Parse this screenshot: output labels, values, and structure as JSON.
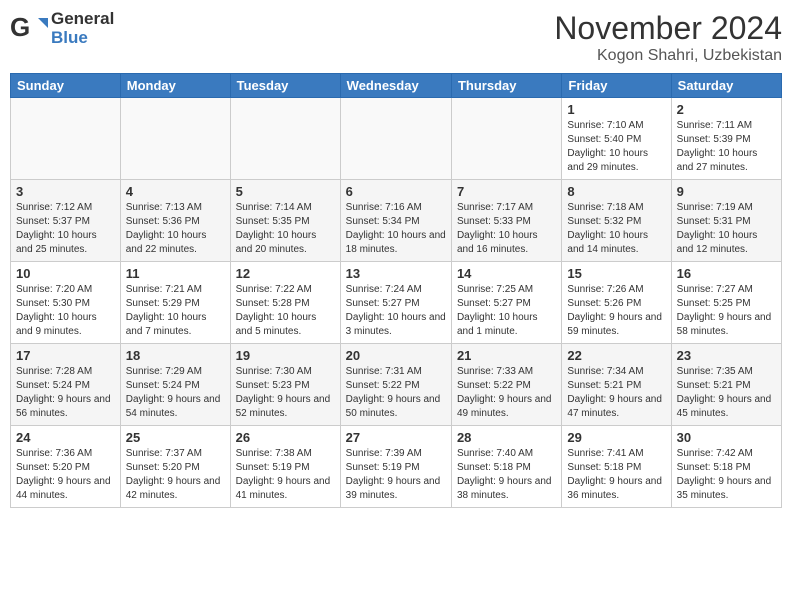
{
  "header": {
    "logo_general": "General",
    "logo_blue": "Blue",
    "month_title": "November 2024",
    "location": "Kogon Shahri, Uzbekistan"
  },
  "days_of_week": [
    "Sunday",
    "Monday",
    "Tuesday",
    "Wednesday",
    "Thursday",
    "Friday",
    "Saturday"
  ],
  "weeks": [
    {
      "days": [
        {
          "num": "",
          "info": ""
        },
        {
          "num": "",
          "info": ""
        },
        {
          "num": "",
          "info": ""
        },
        {
          "num": "",
          "info": ""
        },
        {
          "num": "",
          "info": ""
        },
        {
          "num": "1",
          "info": "Sunrise: 7:10 AM\nSunset: 5:40 PM\nDaylight: 10 hours and 29 minutes."
        },
        {
          "num": "2",
          "info": "Sunrise: 7:11 AM\nSunset: 5:39 PM\nDaylight: 10 hours and 27 minutes."
        }
      ]
    },
    {
      "days": [
        {
          "num": "3",
          "info": "Sunrise: 7:12 AM\nSunset: 5:37 PM\nDaylight: 10 hours and 25 minutes."
        },
        {
          "num": "4",
          "info": "Sunrise: 7:13 AM\nSunset: 5:36 PM\nDaylight: 10 hours and 22 minutes."
        },
        {
          "num": "5",
          "info": "Sunrise: 7:14 AM\nSunset: 5:35 PM\nDaylight: 10 hours and 20 minutes."
        },
        {
          "num": "6",
          "info": "Sunrise: 7:16 AM\nSunset: 5:34 PM\nDaylight: 10 hours and 18 minutes."
        },
        {
          "num": "7",
          "info": "Sunrise: 7:17 AM\nSunset: 5:33 PM\nDaylight: 10 hours and 16 minutes."
        },
        {
          "num": "8",
          "info": "Sunrise: 7:18 AM\nSunset: 5:32 PM\nDaylight: 10 hours and 14 minutes."
        },
        {
          "num": "9",
          "info": "Sunrise: 7:19 AM\nSunset: 5:31 PM\nDaylight: 10 hours and 12 minutes."
        }
      ]
    },
    {
      "days": [
        {
          "num": "10",
          "info": "Sunrise: 7:20 AM\nSunset: 5:30 PM\nDaylight: 10 hours and 9 minutes."
        },
        {
          "num": "11",
          "info": "Sunrise: 7:21 AM\nSunset: 5:29 PM\nDaylight: 10 hours and 7 minutes."
        },
        {
          "num": "12",
          "info": "Sunrise: 7:22 AM\nSunset: 5:28 PM\nDaylight: 10 hours and 5 minutes."
        },
        {
          "num": "13",
          "info": "Sunrise: 7:24 AM\nSunset: 5:27 PM\nDaylight: 10 hours and 3 minutes."
        },
        {
          "num": "14",
          "info": "Sunrise: 7:25 AM\nSunset: 5:27 PM\nDaylight: 10 hours and 1 minute."
        },
        {
          "num": "15",
          "info": "Sunrise: 7:26 AM\nSunset: 5:26 PM\nDaylight: 9 hours and 59 minutes."
        },
        {
          "num": "16",
          "info": "Sunrise: 7:27 AM\nSunset: 5:25 PM\nDaylight: 9 hours and 58 minutes."
        }
      ]
    },
    {
      "days": [
        {
          "num": "17",
          "info": "Sunrise: 7:28 AM\nSunset: 5:24 PM\nDaylight: 9 hours and 56 minutes."
        },
        {
          "num": "18",
          "info": "Sunrise: 7:29 AM\nSunset: 5:24 PM\nDaylight: 9 hours and 54 minutes."
        },
        {
          "num": "19",
          "info": "Sunrise: 7:30 AM\nSunset: 5:23 PM\nDaylight: 9 hours and 52 minutes."
        },
        {
          "num": "20",
          "info": "Sunrise: 7:31 AM\nSunset: 5:22 PM\nDaylight: 9 hours and 50 minutes."
        },
        {
          "num": "21",
          "info": "Sunrise: 7:33 AM\nSunset: 5:22 PM\nDaylight: 9 hours and 49 minutes."
        },
        {
          "num": "22",
          "info": "Sunrise: 7:34 AM\nSunset: 5:21 PM\nDaylight: 9 hours and 47 minutes."
        },
        {
          "num": "23",
          "info": "Sunrise: 7:35 AM\nSunset: 5:21 PM\nDaylight: 9 hours and 45 minutes."
        }
      ]
    },
    {
      "days": [
        {
          "num": "24",
          "info": "Sunrise: 7:36 AM\nSunset: 5:20 PM\nDaylight: 9 hours and 44 minutes."
        },
        {
          "num": "25",
          "info": "Sunrise: 7:37 AM\nSunset: 5:20 PM\nDaylight: 9 hours and 42 minutes."
        },
        {
          "num": "26",
          "info": "Sunrise: 7:38 AM\nSunset: 5:19 PM\nDaylight: 9 hours and 41 minutes."
        },
        {
          "num": "27",
          "info": "Sunrise: 7:39 AM\nSunset: 5:19 PM\nDaylight: 9 hours and 39 minutes."
        },
        {
          "num": "28",
          "info": "Sunrise: 7:40 AM\nSunset: 5:18 PM\nDaylight: 9 hours and 38 minutes."
        },
        {
          "num": "29",
          "info": "Sunrise: 7:41 AM\nSunset: 5:18 PM\nDaylight: 9 hours and 36 minutes."
        },
        {
          "num": "30",
          "info": "Sunrise: 7:42 AM\nSunset: 5:18 PM\nDaylight: 9 hours and 35 minutes."
        }
      ]
    }
  ]
}
